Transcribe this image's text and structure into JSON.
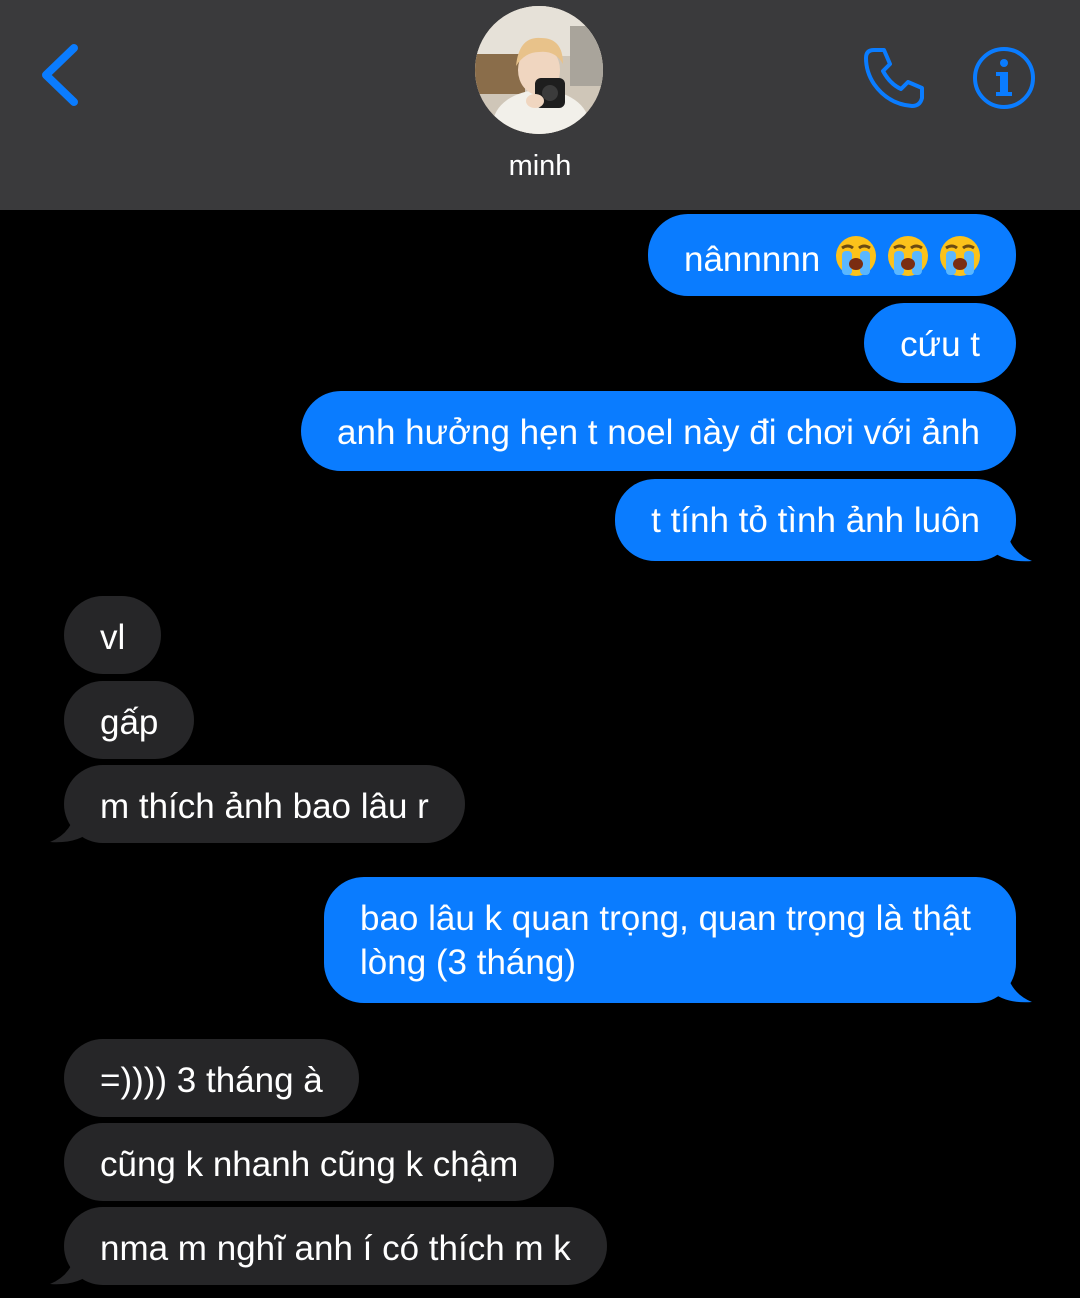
{
  "header": {
    "contact_name": "minh",
    "back_icon": "chevron-left-icon",
    "call_icon": "phone-icon",
    "info_icon": "info-icon",
    "accent_color": "#0a7cff",
    "background_color": "#3a3a3c"
  },
  "messages": [
    {
      "direction": "sent",
      "text": "nânnnnn",
      "emoji": [
        "loudly-crying-face",
        "loudly-crying-face",
        "loudly-crying-face"
      ]
    },
    {
      "direction": "sent",
      "text": "cứu t"
    },
    {
      "direction": "sent",
      "text": "anh hưởng hẹn t noel này đi chơi với ảnh"
    },
    {
      "direction": "sent",
      "text": "t tính tỏ tình ảnh luôn"
    },
    {
      "direction": "received",
      "text": "vl"
    },
    {
      "direction": "received",
      "text": "gấp"
    },
    {
      "direction": "received",
      "text": "m thích ảnh bao lâu r"
    },
    {
      "direction": "sent",
      "text_line1": "bao lâu k quan trọng, quan trọng là thật",
      "text_line2": "lòng (3 tháng)"
    },
    {
      "direction": "received",
      "text": "=)))) 3 tháng à"
    },
    {
      "direction": "received",
      "text": "cũng k nhanh cũng k chậm"
    },
    {
      "direction": "received",
      "text": "nma m nghĩ anh í có thích m k"
    }
  ],
  "colors": {
    "sent_bubble": "#0a7cff",
    "received_bubble": "#262628",
    "chat_background": "#000000"
  }
}
